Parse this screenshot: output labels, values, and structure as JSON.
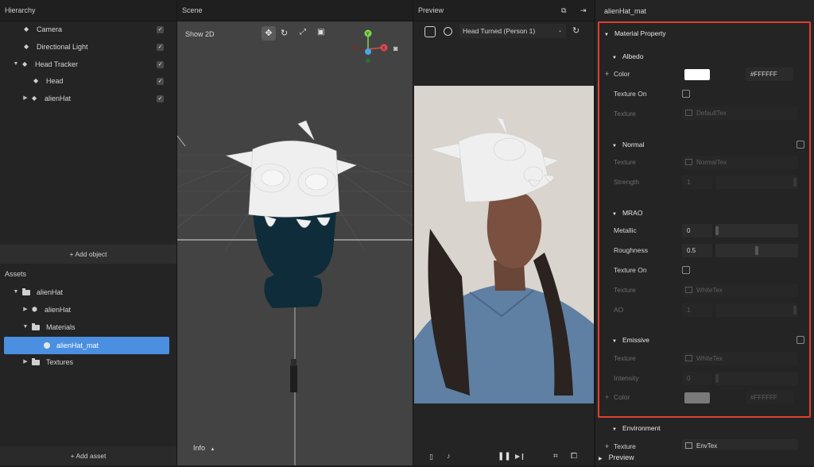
{
  "hierarchy": {
    "title": "Hierarchy",
    "items": [
      {
        "label": "Camera",
        "checked": true
      },
      {
        "label": "Directional Light",
        "checked": true
      },
      {
        "label": "Head Tracker",
        "checked": true
      },
      {
        "label": "Head",
        "checked": true
      },
      {
        "label": "alienHat",
        "checked": true
      }
    ],
    "add_object": "+ Add object"
  },
  "assets": {
    "title": "Assets",
    "items": [
      {
        "label": "alienHat"
      },
      {
        "label": "alienHat"
      },
      {
        "label": "Materials"
      },
      {
        "label": "alienHat_mat"
      },
      {
        "label": "Textures"
      }
    ],
    "add_asset": "+ Add asset"
  },
  "scene": {
    "title": "Scene",
    "show2d": "Show 2D",
    "info": "Info",
    "info_arrow": "▲",
    "gizmo": {
      "y": "Y",
      "x": "X"
    }
  },
  "preview": {
    "title": "Preview",
    "dropdown": "Head Turned (Person 1)"
  },
  "inspector": {
    "title": "alienHat_mat",
    "material_property": "Material Property",
    "albedo": {
      "title": "Albedo",
      "color_label": "Color",
      "color_hex": "#FFFFFF",
      "texture_on": "Texture On",
      "texture_label": "Texture",
      "texture_value": "DefaultTex"
    },
    "normal": {
      "title": "Normal",
      "texture_label": "Texture",
      "texture_value": "NormalTex",
      "strength_label": "Strength",
      "strength_value": "1"
    },
    "mrao": {
      "title": "MRAO",
      "metallic_label": "Metallic",
      "metallic_value": "0",
      "roughness_label": "Roughness",
      "roughness_value": "0.5",
      "texture_on": "Texture On",
      "texture_label": "Texture",
      "texture_value": "WhiteTex",
      "ao_label": "AO",
      "ao_value": "1"
    },
    "emissive": {
      "title": "Emissive",
      "texture_label": "Texture",
      "texture_value": "WhiteTex",
      "intensity_label": "Intensity",
      "intensity_value": "0",
      "color_label": "Color",
      "color_hex": "#FFFFFF"
    },
    "environment": {
      "title": "Environment",
      "texture_label": "Texture",
      "texture_value": "EnvTex"
    },
    "preview_section": "Preview"
  },
  "colors": {
    "accent": "#4a8fe0",
    "highlight_border": "#e0402f"
  }
}
